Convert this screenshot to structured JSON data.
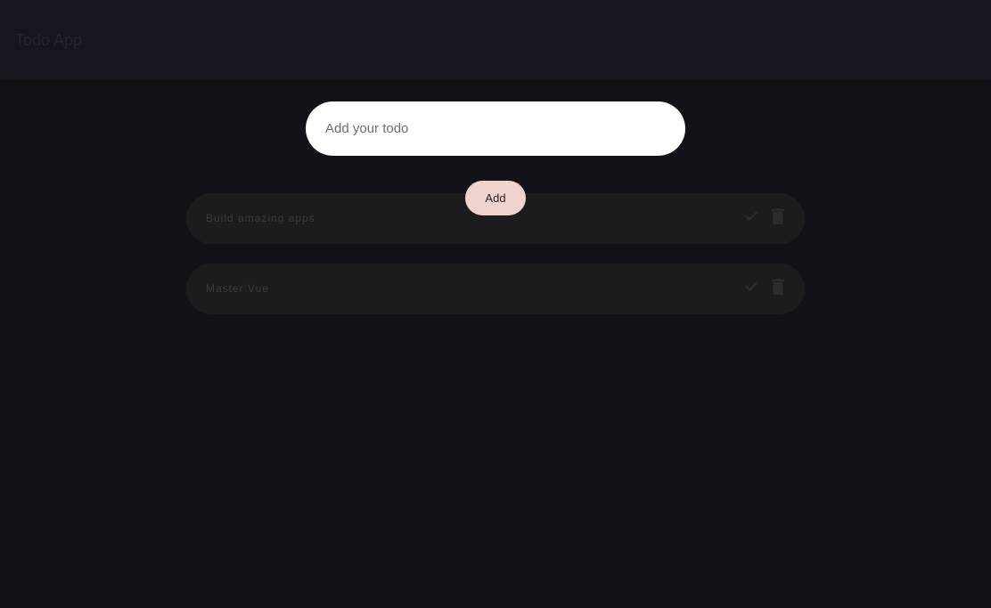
{
  "app_bar": {
    "title": "Todo App"
  },
  "todo_form": {
    "placeholder": "Add your todo",
    "value": "",
    "add_label": "Add"
  },
  "todos": [
    {
      "text": "Build amazing apps",
      "complete_icon": "check-icon",
      "delete_icon": "trash-icon"
    },
    {
      "text": "Master Vue",
      "complete_icon": "check-icon",
      "delete_icon": "trash-icon"
    }
  ],
  "colors": {
    "background": "#131218",
    "app_bar": "#17161f",
    "input_bg": "#ffffff",
    "add_button_bg": "#f0d3cc",
    "todo_item_bg": "#1c1b1d",
    "muted_text": "#3b3a3e",
    "icon_color": "#2c2b30"
  }
}
